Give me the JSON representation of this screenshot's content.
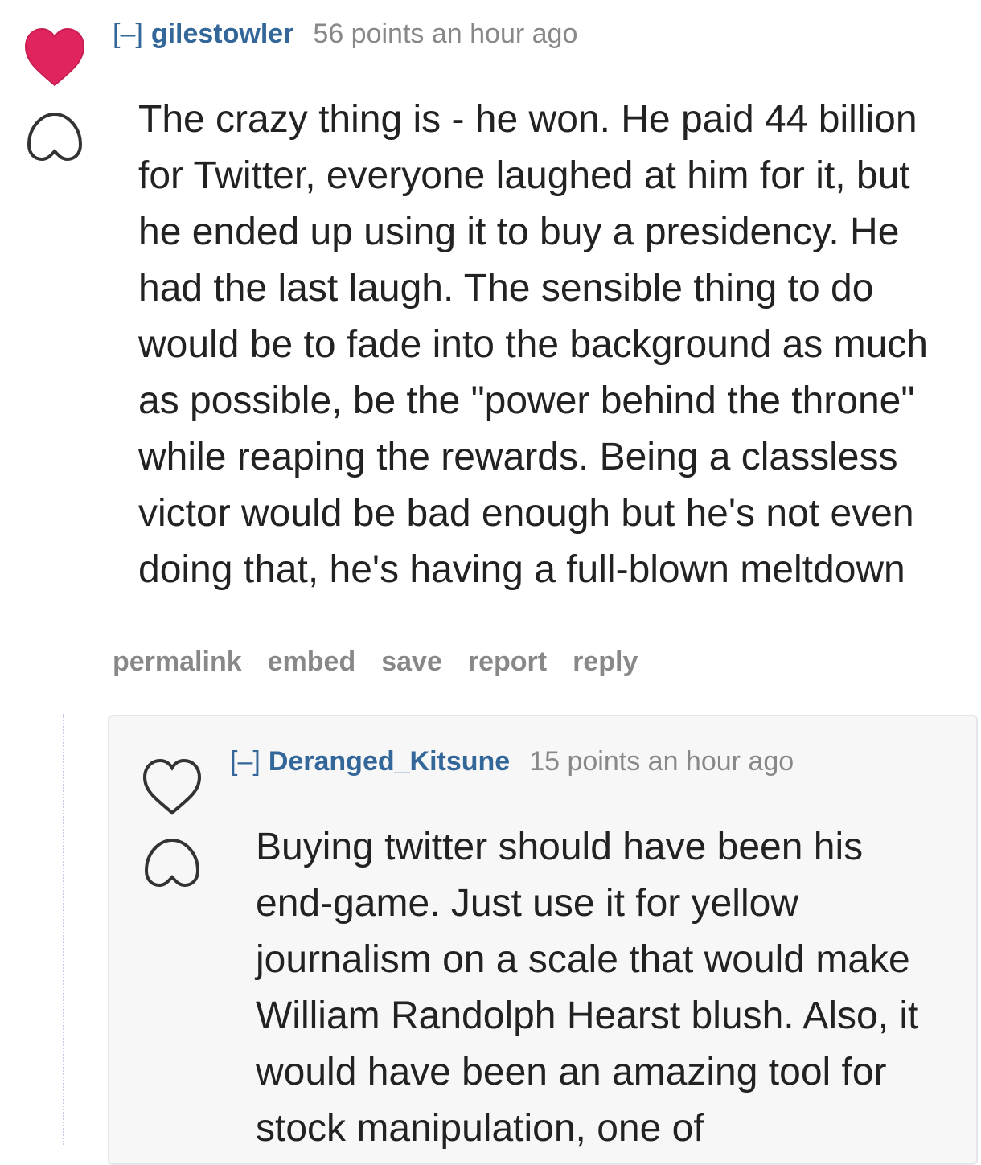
{
  "comments": [
    {
      "collapse_label": "[–]",
      "author": "gilestowler",
      "points": "56 points",
      "time": "an hour ago",
      "upvoted": true,
      "body": "The crazy thing is - he won. He paid 44 billion for Twitter, everyone laughed at him for it, but he ended up using it to buy a presidency. He had the last laugh. The sensible thing to do would be to fade into the background as much as possible, be the \"power behind the throne\" while reaping the rewards. Being a classless victor would be bad enough but he's not even doing that, he's having a full-blown meltdown",
      "actions": [
        "permalink",
        "embed",
        "save",
        "report",
        "reply"
      ]
    },
    {
      "collapse_label": "[–]",
      "author": "Deranged_Kitsune",
      "points": "15 points",
      "time": "an hour ago",
      "upvoted": false,
      "body": "Buying twitter should have been his end-game. Just use it for yellow journalism on a scale that would make William Randolph Hearst blush. Also, it would have been an amazing tool for stock manipulation, one of"
    }
  ],
  "colors": {
    "upvote_active": "#e0245e",
    "link": "#336699",
    "meta": "#888888"
  },
  "icons": {
    "upvote": "heart-icon",
    "downvote": "broken-heart-icon"
  }
}
